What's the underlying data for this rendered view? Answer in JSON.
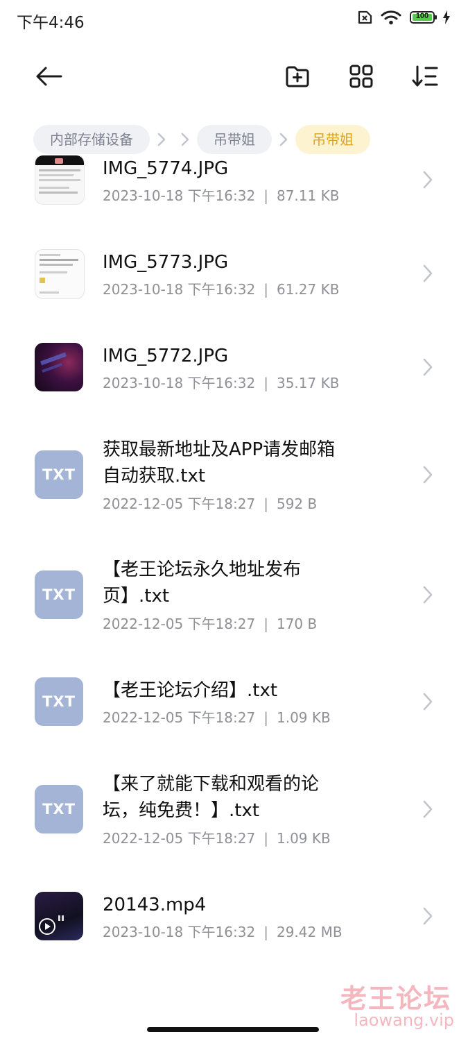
{
  "status_bar": {
    "time": "下午4:46",
    "battery": "100"
  },
  "breadcrumb": [
    "内部存储设备",
    "吊带姐",
    "吊带姐"
  ],
  "files": [
    {
      "name": "IMG_5774.JPG",
      "date": "2023-10-18 下午16:32",
      "size": "87.11 KB",
      "thumb": "screenshot-chat"
    },
    {
      "name": "IMG_5773.JPG",
      "date": "2023-10-18 下午16:32",
      "size": "61.27 KB",
      "thumb": "screenshot-chat"
    },
    {
      "name": "IMG_5772.JPG",
      "date": "2023-10-18 下午16:32",
      "size": "35.17 KB",
      "thumb": "dark-photo"
    },
    {
      "name_line1": "获取最新地址及APP请发邮箱",
      "name_line2": "自动获取.txt",
      "date": "2022-12-05 下午18:27",
      "size": "592 B",
      "thumb": "TXT"
    },
    {
      "name_line1": "【老王论坛永久地址发布",
      "name_line2": "页】.txt",
      "date": "2022-12-05 下午18:27",
      "size": "170 B",
      "thumb": "TXT"
    },
    {
      "name": "【老王论坛介绍】.txt",
      "date": "2022-12-05 下午18:27",
      "size": "1.09 KB",
      "thumb": "TXT"
    },
    {
      "name_line1": "【来了就能下载和观看的论",
      "name_line2": "坛，纯免费！】.txt",
      "date": "2022-12-05 下午18:27",
      "size": "1.09 KB",
      "thumb": "TXT"
    },
    {
      "name": "20143.mp4",
      "date": "2023-10-18 下午16:32",
      "size": "29.42 MB",
      "thumb": "video"
    }
  ],
  "watermark": {
    "title": "老王论坛",
    "url": "laowang.vip"
  }
}
